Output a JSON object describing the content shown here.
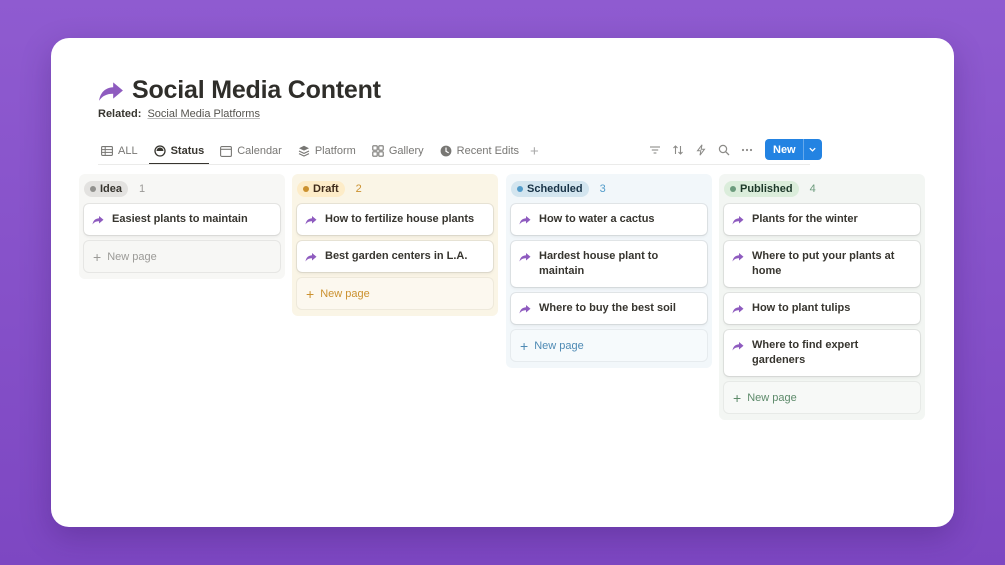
{
  "page": {
    "title": "Social Media Content",
    "related_label": "Related:",
    "related_value": "Social Media Platforms"
  },
  "tabs": [
    {
      "label": "ALL",
      "icon": "table-icon"
    },
    {
      "label": "Status",
      "icon": "status-icon",
      "active": true
    },
    {
      "label": "Calendar",
      "icon": "calendar-icon"
    },
    {
      "label": "Platform",
      "icon": "stack-icon"
    },
    {
      "label": "Gallery",
      "icon": "gallery-icon"
    },
    {
      "label": "Recent Edits",
      "icon": "clock-icon"
    }
  ],
  "toolbar": {
    "new_label": "New",
    "icons": [
      "filter-icon",
      "sort-icon",
      "lightning-icon",
      "search-icon",
      "more-icon"
    ]
  },
  "colors": {
    "accent": "#2383e2",
    "icon_purple": "#8e5bbf"
  },
  "columns": [
    {
      "name": "Idea",
      "count": "1",
      "bg": "#f7f7f5",
      "pill_bg": "#e3e2e0",
      "dot": "#91918e",
      "pill_text": "#37352f",
      "count_color": "#9b9a97",
      "new_color": "#9b9a97",
      "items": [
        "Easiest plants to maintain"
      ],
      "new_label": "New page"
    },
    {
      "name": "Draft",
      "count": "2",
      "bg": "#faf5e6",
      "pill_bg": "#fdecc8",
      "dot": "#cb912f",
      "pill_text": "#402c1b",
      "count_color": "#cb912f",
      "new_color": "#cb912f",
      "items": [
        "How to fertilize house plants",
        "Best garden centers in L.A."
      ],
      "new_label": "New page"
    },
    {
      "name": "Scheduled",
      "count": "3",
      "bg": "#f2f7fa",
      "pill_bg": "#d3e5ef",
      "dot": "#529cca",
      "pill_text": "#183347",
      "count_color": "#529cca",
      "new_color": "#4e8ab4",
      "items": [
        "How to water a cactus",
        "Hardest house plant to maintain",
        "Where to buy the best soil"
      ],
      "new_label": "New page"
    },
    {
      "name": "Published",
      "count": "4",
      "bg": "#f3f6f3",
      "pill_bg": "#dbeddb",
      "dot": "#6c9b7d",
      "pill_text": "#1c3829",
      "count_color": "#6c9b7d",
      "new_color": "#5d8a6a",
      "items": [
        "Plants for the winter",
        "Where to put your plants at home",
        "How to plant tulips",
        "Where to find expert gardeners"
      ],
      "new_label": "New page"
    }
  ]
}
